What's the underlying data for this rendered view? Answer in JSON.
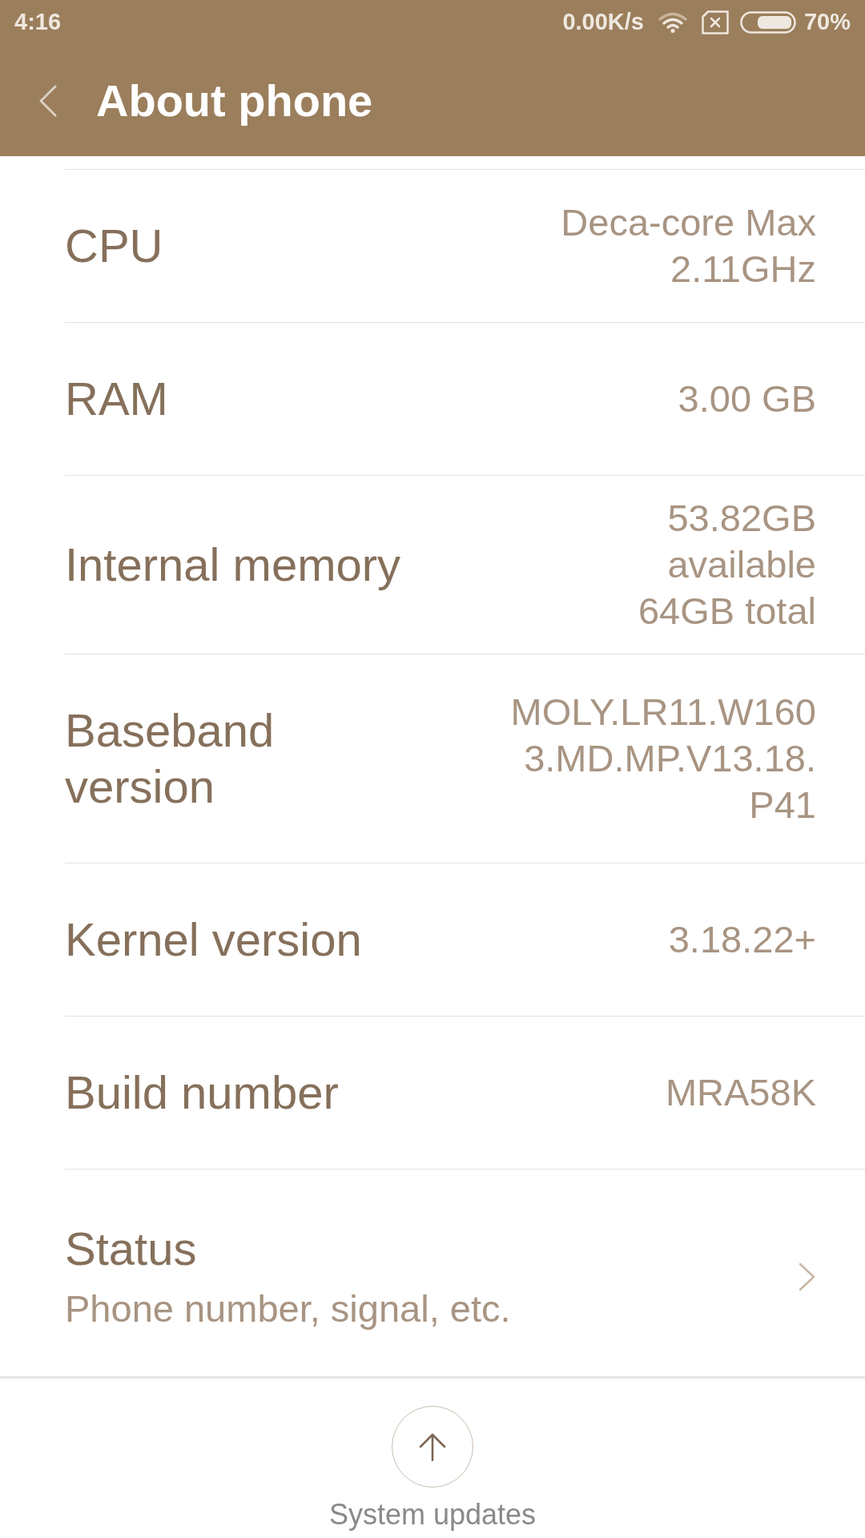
{
  "status_bar": {
    "time": "4:16",
    "network_speed": "0.00K/s",
    "battery": "70%"
  },
  "header": {
    "title": "About phone"
  },
  "rows": [
    {
      "kind": "info",
      "label_lines": [
        "CPU"
      ],
      "value_lines": [
        "Deca-core Max",
        "2.11GHz"
      ]
    },
    {
      "kind": "info",
      "label_lines": [
        "RAM"
      ],
      "value_lines": [
        "3.00 GB"
      ]
    },
    {
      "kind": "info",
      "label_lines": [
        "Internal memory"
      ],
      "value_lines": [
        "53.82GB",
        "available",
        "64GB total"
      ]
    },
    {
      "kind": "info",
      "label_lines": [
        "Baseband",
        "version"
      ],
      "value_lines": [
        "MOLY.LR11.W160",
        "3.MD.MP.V13.18.",
        "P41"
      ]
    },
    {
      "kind": "info",
      "label_lines": [
        "Kernel version"
      ],
      "value_lines": [
        "3.18.22+"
      ]
    },
    {
      "kind": "info",
      "label_lines": [
        "Build number"
      ],
      "value_lines": [
        "MRA58K"
      ]
    },
    {
      "kind": "link",
      "title": "Status",
      "subtitle": "Phone number, signal, etc."
    }
  ],
  "bottom_action": {
    "label": "System updates"
  }
}
